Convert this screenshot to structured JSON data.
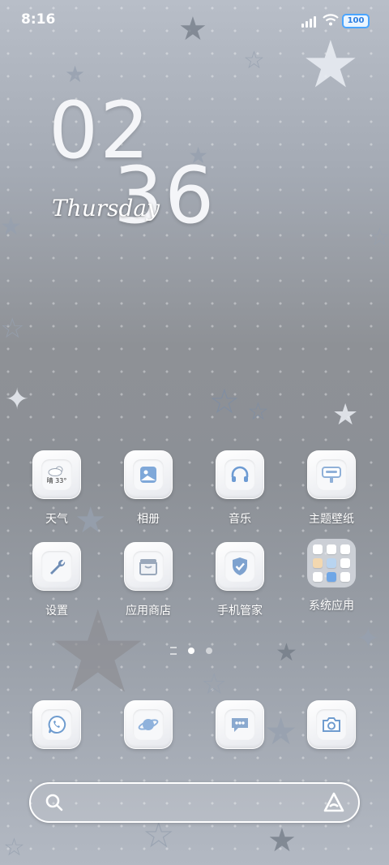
{
  "status_bar": {
    "time": "8:16",
    "battery": "100"
  },
  "clock": {
    "hour": "02",
    "minute": "36",
    "day": "Thursday"
  },
  "apps_row1": [
    {
      "label": "天气",
      "icon": "weather-icon",
      "weather_text": "晴 33°"
    },
    {
      "label": "相册",
      "icon": "gallery-icon"
    },
    {
      "label": "音乐",
      "icon": "music-icon"
    },
    {
      "label": "主题壁纸",
      "icon": "themes-icon"
    }
  ],
  "apps_row2": [
    {
      "label": "设置",
      "icon": "settings-icon"
    },
    {
      "label": "应用商店",
      "icon": "app-store-icon"
    },
    {
      "label": "手机管家",
      "icon": "security-icon"
    },
    {
      "label": "系统应用",
      "icon": "folder-icon"
    }
  ],
  "dock": [
    {
      "icon": "phone-icon"
    },
    {
      "icon": "browser-icon"
    },
    {
      "icon": "messages-icon"
    },
    {
      "icon": "camera-icon"
    }
  ],
  "page_indicator": {
    "pages": 2,
    "active": 0
  },
  "colors": {
    "accent": "#4a7fc9",
    "battery": "#4aa5ff"
  }
}
